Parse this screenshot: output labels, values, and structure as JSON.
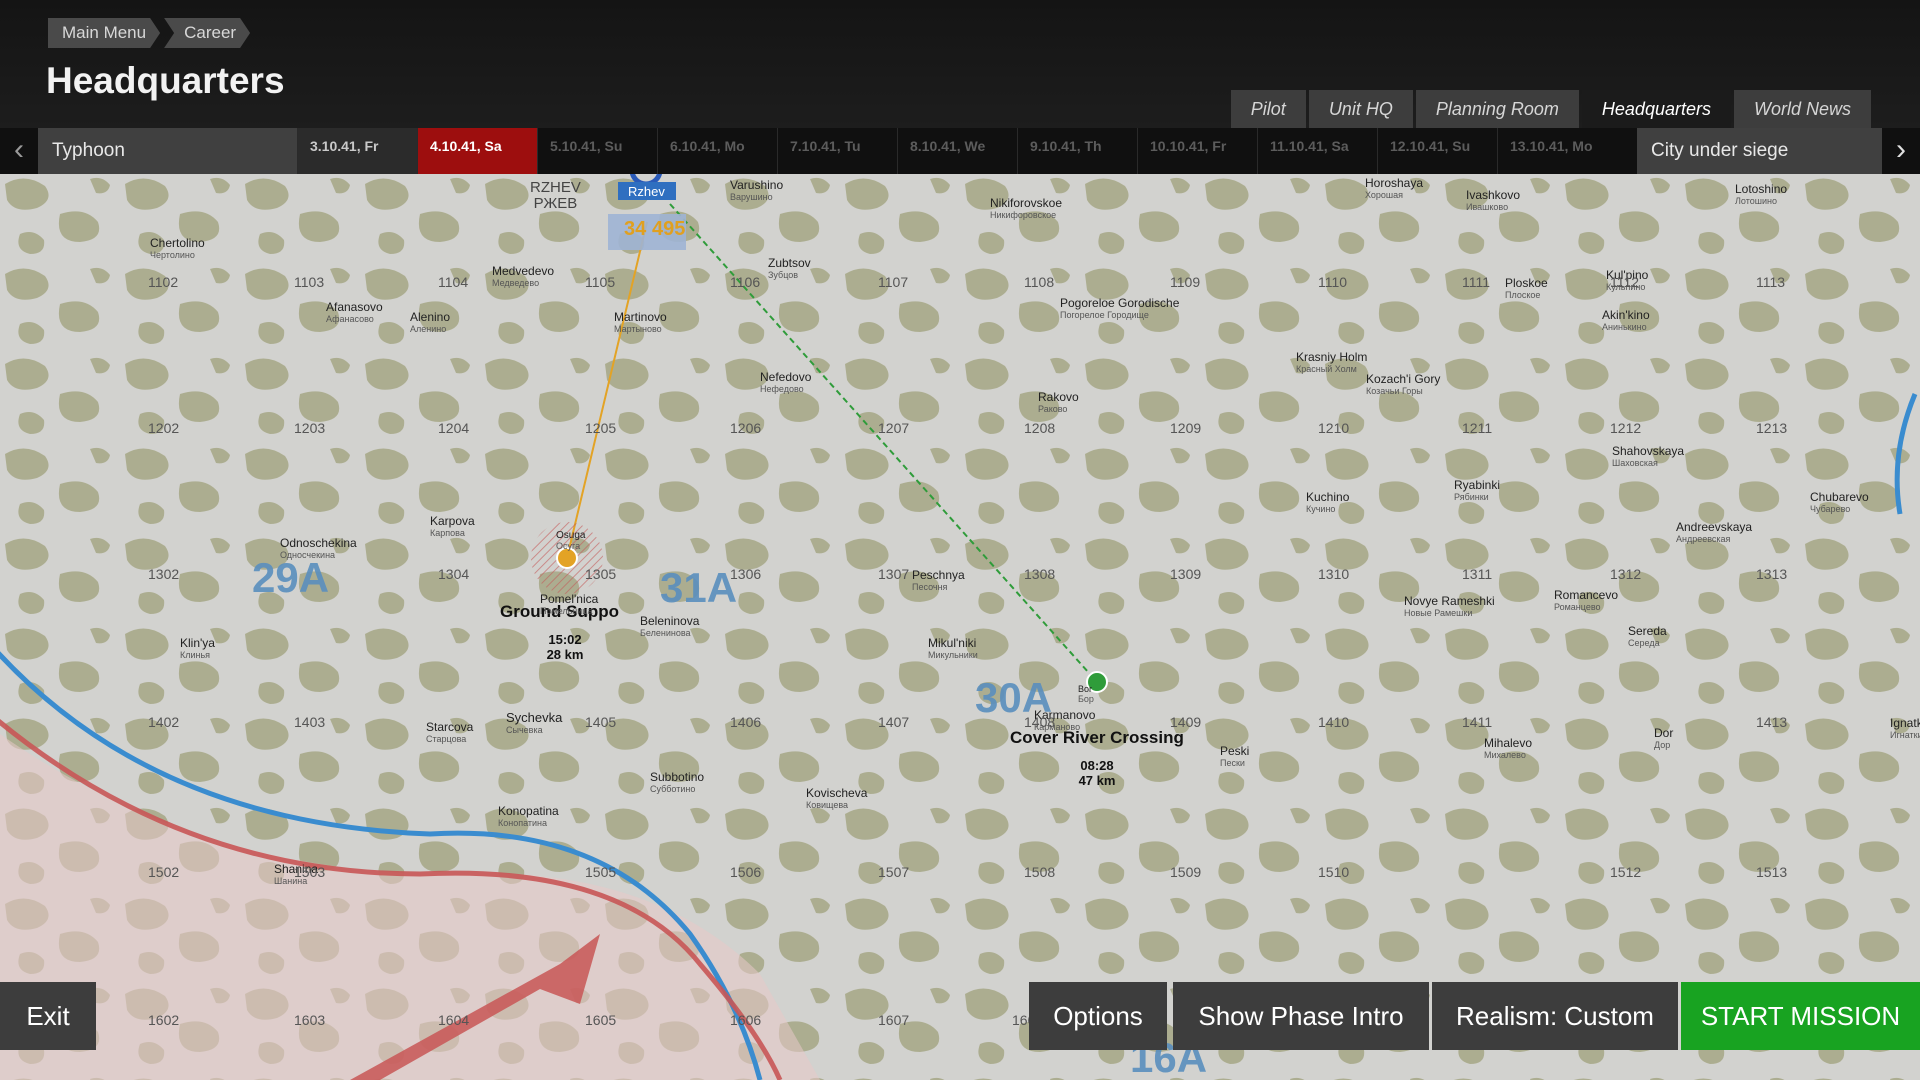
{
  "breadcrumb": [
    "Main Menu",
    "Career"
  ],
  "page_title": "Headquarters",
  "tabs": [
    {
      "label": "Pilot"
    },
    {
      "label": "Unit HQ"
    },
    {
      "label": "Planning Room"
    },
    {
      "label": "Headquarters",
      "active": true
    },
    {
      "label": "World News"
    }
  ],
  "timeline": {
    "operation": "Typhoon",
    "phase": "City under siege",
    "dates": [
      "3.10.41, Fr",
      "4.10.41, Sa",
      "5.10.41, Su",
      "6.10.41, Mo",
      "7.10.41, Tu",
      "8.10.41, We",
      "9.10.41, Th",
      "10.10.41, Fr",
      "11.10.41, Sa",
      "12.10.41, Su",
      "13.10.41, Mo"
    ],
    "current_date": "4.10.41, Sa"
  },
  "map": {
    "airfield": {
      "name": "Rzhev",
      "badge_a": "34",
      "badge_b": "495"
    },
    "rzhev_city": {
      "en": "RZHEV",
      "ru": "РЖЕВ"
    },
    "armies": [
      "29A",
      "31A",
      "30A",
      "16A"
    ],
    "grid_labels": [
      "1102",
      "1103",
      "1104",
      "1105",
      "1106",
      "1107",
      "1108",
      "1109",
      "1110",
      "1111",
      "1112",
      "1113",
      "1202",
      "1203",
      "1204",
      "1205",
      "1206",
      "1207",
      "1208",
      "1209",
      "1210",
      "1211",
      "1212",
      "1213",
      "1302",
      "1304",
      "1305",
      "1306",
      "1307",
      "1308",
      "1309",
      "1310",
      "1311",
      "1312",
      "1313",
      "1402",
      "1403",
      "1405",
      "1406",
      "1407",
      "1408",
      "1409",
      "1410",
      "1411",
      "1413",
      "1502",
      "1503",
      "1505",
      "1506",
      "1507",
      "1508",
      "1509",
      "1510",
      "1512",
      "1513",
      "1602",
      "1603",
      "1604",
      "1605",
      "1606",
      "1607",
      "160"
    ],
    "towns": [
      {
        "en": "Chertolino",
        "ru": "Чертолино"
      },
      {
        "en": "Medvedevo",
        "ru": "Медведево"
      },
      {
        "en": "Afanasovo",
        "ru": "Афанасово"
      },
      {
        "en": "Alenino",
        "ru": "Аленино"
      },
      {
        "en": "Martinovo",
        "ru": "Мартыново"
      },
      {
        "en": "Varushino",
        "ru": "Варушино"
      },
      {
        "en": "Zubtsov",
        "ru": "Зубцов"
      },
      {
        "en": "Nikiforovskoe",
        "ru": "Никифоровское"
      },
      {
        "en": "Pogoreloe Gorodische",
        "ru": "Погорелое Городище"
      },
      {
        "en": "Nefedovo",
        "ru": "Нефедово"
      },
      {
        "en": "Rakovo",
        "ru": "Раково"
      },
      {
        "en": "Horoshaya",
        "ru": "Хорошая"
      },
      {
        "en": "Ivashkovo",
        "ru": "Ивашково"
      },
      {
        "en": "Lotoshino",
        "ru": "Лотошино"
      },
      {
        "en": "Ploskoe",
        "ru": "Плоское"
      },
      {
        "en": "Kul'pino",
        "ru": "Кульпино"
      },
      {
        "en": "Akin'kino",
        "ru": "Анинькино"
      },
      {
        "en": "Krasniy Holm",
        "ru": "Красный Холм"
      },
      {
        "en": "Kozach'i Gory",
        "ru": "Козачьи Горы"
      },
      {
        "en": "Osuga",
        "ru": "Осуга"
      },
      {
        "en": "Karpova",
        "ru": "Карпова"
      },
      {
        "en": "Odnoschekina",
        "ru": "Односчекина"
      },
      {
        "en": "Pomel'nica",
        "ru": "Помельница"
      },
      {
        "en": "Beleninova",
        "ru": "Беленинова"
      },
      {
        "en": "Peschnya",
        "ru": "Песочня"
      },
      {
        "en": "Mikul'niki",
        "ru": "Микульники"
      },
      {
        "en": "Karmanovo",
        "ru": "Карманово"
      },
      {
        "en": "Kuchino",
        "ru": "Кучино"
      },
      {
        "en": "Ryabinki",
        "ru": "Рябинки"
      },
      {
        "en": "Shahovskaya",
        "ru": "Шаховская"
      },
      {
        "en": "Chubarevo",
        "ru": "Чубарево"
      },
      {
        "en": "Andreevskaya",
        "ru": "Андреевская"
      },
      {
        "en": "Novye Rameshki",
        "ru": "Новые Рамешки"
      },
      {
        "en": "Romancevo",
        "ru": "Романцево"
      },
      {
        "en": "Sereda",
        "ru": "Середа"
      },
      {
        "en": "Klin'ya",
        "ru": "Клинья"
      },
      {
        "en": "Starcova",
        "ru": "Старцова"
      },
      {
        "en": "Sychevka",
        "ru": "Сычевка"
      },
      {
        "en": "Subbotino",
        "ru": "Субботино"
      },
      {
        "en": "Kovischeva",
        "ru": "Ковищева"
      },
      {
        "en": "Mihalevo",
        "ru": "Михалево"
      },
      {
        "en": "Peski",
        "ru": "Пески"
      },
      {
        "en": "Dor",
        "ru": "Дор"
      },
      {
        "en": "Ignatki",
        "ru": "Игнатки"
      },
      {
        "en": "Konopatina",
        "ru": "Конопатина"
      },
      {
        "en": "Shanina",
        "ru": "Шанина"
      },
      {
        "en": "Bor",
        "ru": "Бор"
      }
    ],
    "missions": [
      {
        "name": "Ground Suppo",
        "time": "15:02",
        "distance": "28 km",
        "color": "#e3a325"
      },
      {
        "name": "Cover River Crossing",
        "time": "08:28",
        "distance": "47 km",
        "color": "#2f9c3a"
      }
    ]
  },
  "buttons": {
    "exit": "Exit",
    "options": "Options",
    "show_phase_intro": "Show Phase Intro",
    "realism": "Realism: Custom",
    "start_mission": "START MISSION"
  },
  "colors": {
    "active_date": "#9d0e0e",
    "start_button": "#18a321",
    "front_line_blue": "#3a8ccf",
    "front_line_red": "#c85656",
    "army_label": "#5a8fbe"
  }
}
